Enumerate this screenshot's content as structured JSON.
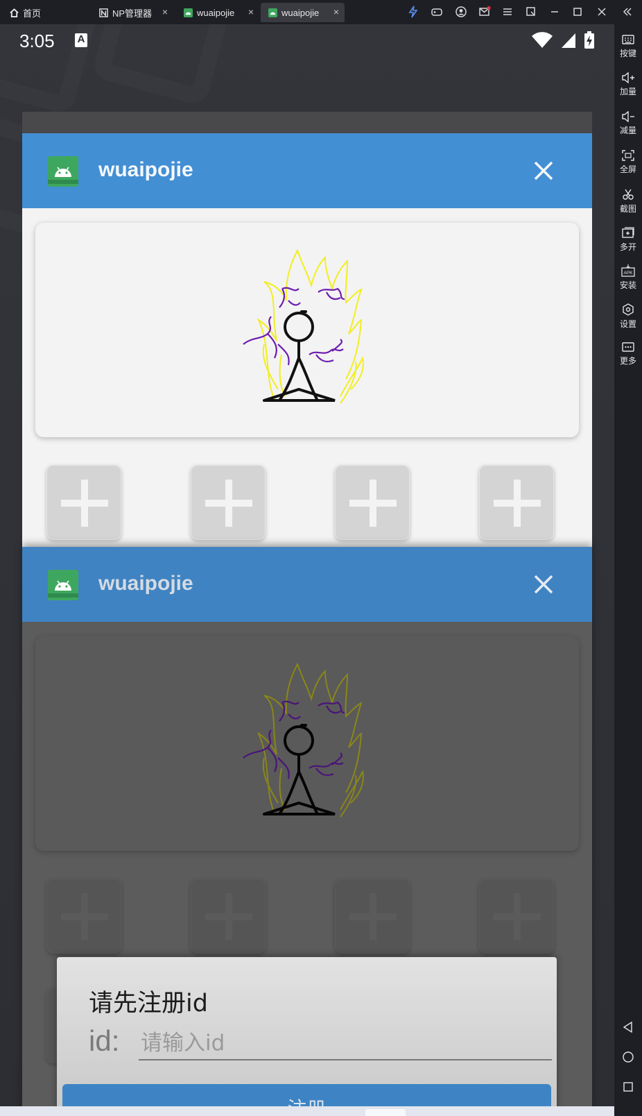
{
  "window": {
    "tabs": [
      {
        "label": "首页",
        "icon": "home-icon"
      },
      {
        "label": "NP管理器",
        "icon": "np-app-icon",
        "close": "×"
      },
      {
        "label": "wuaipojie",
        "icon": "android-app-icon",
        "close": "×"
      },
      {
        "label": "wuaipojie",
        "icon": "android-app-icon",
        "close": "×",
        "active": true
      }
    ],
    "controls": [
      "lightning-icon",
      "gamepad-icon",
      "account-icon",
      "mail-icon",
      "menu-icon",
      "restore-icon",
      "minimize-icon",
      "maximize-icon",
      "close-icon"
    ]
  },
  "sidebar": {
    "items": [
      {
        "label": "按键",
        "icon": "keyboard-icon"
      },
      {
        "label": "加量",
        "icon": "volume-up-icon"
      },
      {
        "label": "减量",
        "icon": "volume-down-icon"
      },
      {
        "label": "全屏",
        "icon": "fullscreen-icon"
      },
      {
        "label": "截图",
        "icon": "scissors-icon"
      },
      {
        "label": "多开",
        "icon": "multi-open-icon"
      },
      {
        "label": "安装",
        "icon": "apk-install-icon"
      },
      {
        "label": "设置",
        "icon": "settings-icon"
      },
      {
        "label": "更多",
        "icon": "more-icon"
      }
    ],
    "nav": [
      "back-icon",
      "home-icon",
      "recents-icon"
    ]
  },
  "status_bar": {
    "time": "3:05",
    "notification_icon": "A"
  },
  "recents": {
    "cards": [
      {
        "title": "wuaipojie",
        "close_icon": "close-icon"
      },
      {
        "title": "wuaipojie",
        "close_icon": "close-icon"
      }
    ]
  },
  "dialog": {
    "title": "请先注册id",
    "id_label": "id:",
    "id_placeholder": "请输入id",
    "id_value": "",
    "register_label": "注册"
  },
  "colors": {
    "header_blue": "#438fd4",
    "android_green": "#3ea75f",
    "dialog_button": "#3e84c4"
  }
}
